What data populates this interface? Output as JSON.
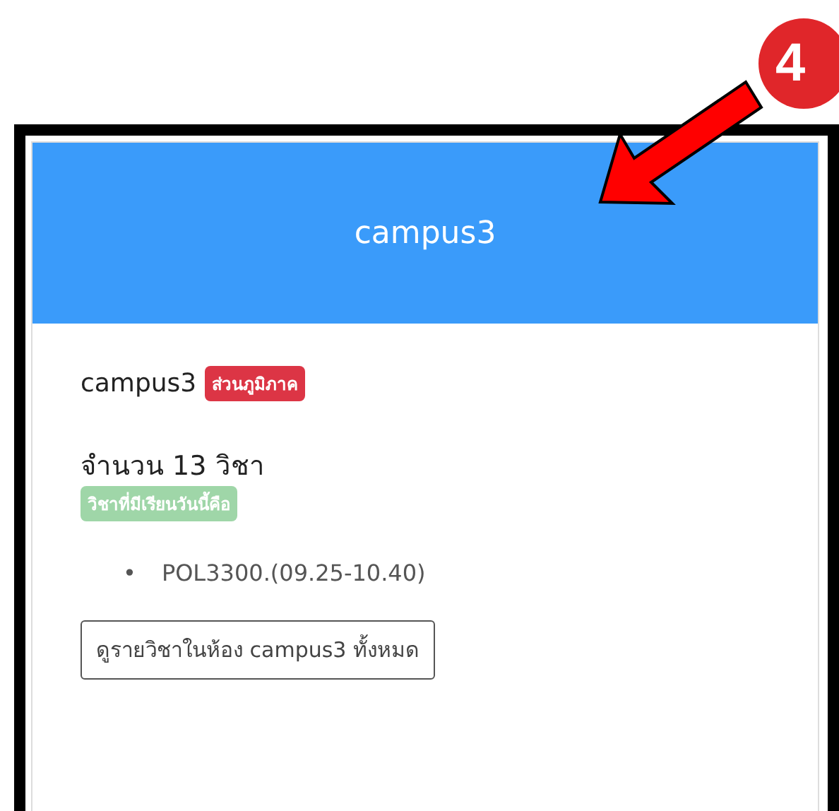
{
  "annotation": {
    "step": "4"
  },
  "card": {
    "title": "campus3",
    "room": "campus3",
    "room_tag": "ส่วนภูมิภาค",
    "count_text": "จำนวน 13 วิชา",
    "today_tag": "วิชาที่มีเรียนวันนี้คือ",
    "courses": [
      {
        "bullet": "•",
        "text": "POL3300.(09.25-10.40)"
      }
    ],
    "button": "ดูรายวิชาในห้อง campus3 ทั้งหมด"
  }
}
